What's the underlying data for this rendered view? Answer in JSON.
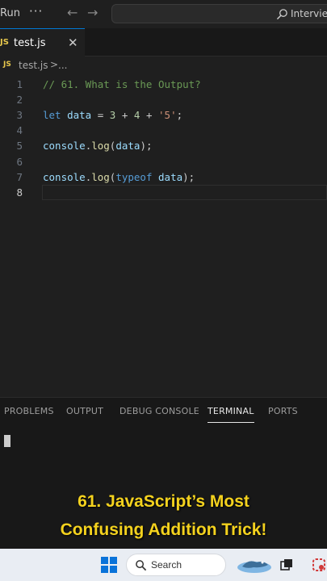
{
  "titlebar": {
    "run_menu": "Run",
    "more": "···",
    "nav_back": "←",
    "nav_forward": "→",
    "command_center": "Interview"
  },
  "tab": {
    "badge": "JS",
    "label": "test.js",
    "close": "✕"
  },
  "breadcrumb": {
    "badge": "JS",
    "file": "test.js",
    "separator": ">",
    "more": "..."
  },
  "editor": {
    "current_line": 8,
    "lines": [
      {
        "num": "1",
        "tokens": [
          {
            "t": "// 61. What is the Output?",
            "k": "comment"
          }
        ]
      },
      {
        "num": "2",
        "tokens": []
      },
      {
        "num": "3",
        "tokens": [
          {
            "t": "let",
            "k": "keyword"
          },
          {
            "t": " ",
            "k": "plain"
          },
          {
            "t": "data",
            "k": "var"
          },
          {
            "t": " = ",
            "k": "plain"
          },
          {
            "t": "3",
            "k": "num"
          },
          {
            "t": " + ",
            "k": "plain"
          },
          {
            "t": "4",
            "k": "num"
          },
          {
            "t": " + ",
            "k": "plain"
          },
          {
            "t": "'5'",
            "k": "str"
          },
          {
            "t": ";",
            "k": "plain"
          }
        ]
      },
      {
        "num": "4",
        "tokens": []
      },
      {
        "num": "5",
        "tokens": [
          {
            "t": "console",
            "k": "var"
          },
          {
            "t": ".",
            "k": "plain"
          },
          {
            "t": "log",
            "k": "fn"
          },
          {
            "t": "(",
            "k": "plain"
          },
          {
            "t": "data",
            "k": "var"
          },
          {
            "t": ");",
            "k": "plain"
          }
        ]
      },
      {
        "num": "6",
        "tokens": []
      },
      {
        "num": "7",
        "tokens": [
          {
            "t": "console",
            "k": "var"
          },
          {
            "t": ".",
            "k": "plain"
          },
          {
            "t": "log",
            "k": "fn"
          },
          {
            "t": "(",
            "k": "plain"
          },
          {
            "t": "typeof",
            "k": "keyword"
          },
          {
            "t": " ",
            "k": "plain"
          },
          {
            "t": "data",
            "k": "var"
          },
          {
            "t": ");",
            "k": "plain"
          }
        ]
      },
      {
        "num": "8",
        "tokens": []
      }
    ]
  },
  "panel": {
    "tabs": [
      {
        "label": "PROBLEMS",
        "active": false
      },
      {
        "label": "OUTPUT",
        "active": false
      },
      {
        "label": "DEBUG CONSOLE",
        "active": false
      },
      {
        "label": "TERMINAL",
        "active": true
      },
      {
        "label": "PORTS",
        "active": false
      }
    ]
  },
  "caption": {
    "line1": "61. JavaScript’s Most",
    "line2": "Confusing Addition Trick!"
  },
  "taskbar": {
    "search_label": "Search"
  },
  "colors": {
    "accent": "#0078d4",
    "caption": "#f4d21e",
    "js_badge": "#e8c84c"
  }
}
